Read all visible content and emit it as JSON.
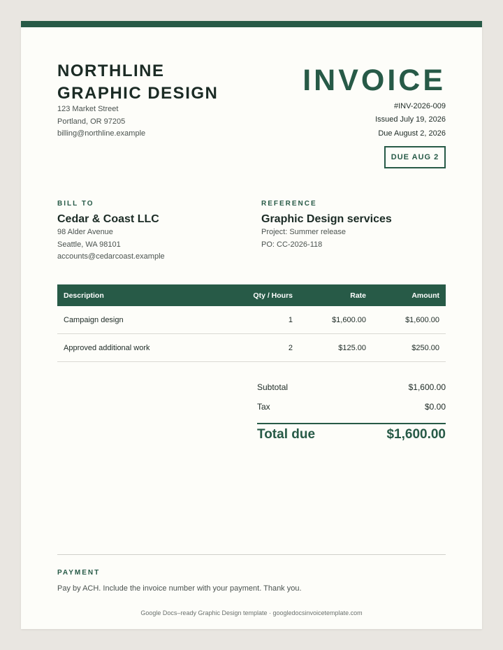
{
  "company": {
    "name_line1": "NORTHLINE",
    "name_line2": "GRAPHIC DESIGN",
    "address1": "123 Market Street",
    "address2": "Portland, OR 97205",
    "email": "billing@northline.example"
  },
  "invoice": {
    "title": "INVOICE",
    "number": "#INV-2026-009",
    "issued": "Issued July 19, 2026",
    "due": "Due August 2, 2026",
    "due_badge": "DUE AUG 2"
  },
  "bill_to": {
    "label": "BILL TO",
    "name": "Cedar & Coast LLC",
    "address1": "98 Alder Avenue",
    "address2": "Seattle, WA 98101",
    "email": "accounts@cedarcoast.example"
  },
  "reference": {
    "label": "REFERENCE",
    "title": "Graphic Design services",
    "project": "Project: Summer release",
    "po": "PO: CC-2026-118"
  },
  "table": {
    "headers": {
      "description": "Description",
      "qty": "Qty / Hours",
      "rate": "Rate",
      "amount": "Amount"
    },
    "rows": [
      {
        "description": "Campaign design",
        "qty": "1",
        "rate": "$1,600.00",
        "amount": "$1,600.00"
      },
      {
        "description": "Approved additional work",
        "qty": "2",
        "rate": "$125.00",
        "amount": "$250.00"
      }
    ]
  },
  "totals": {
    "subtotal_label": "Subtotal",
    "subtotal": "$1,600.00",
    "tax_label": "Tax",
    "tax": "$0.00",
    "total_label": "Total due",
    "total": "$1,600.00"
  },
  "payment": {
    "label": "PAYMENT",
    "text": "Pay by ACH. Include the invoice number with your payment. Thank you."
  },
  "footer": {
    "credit": "Google Docs–ready Graphic Design template · googledocsinvoicetemplate.com"
  },
  "colors": {
    "accent": "#275a47",
    "background": "#e9e6e1",
    "paper": "#fdfdf9"
  }
}
